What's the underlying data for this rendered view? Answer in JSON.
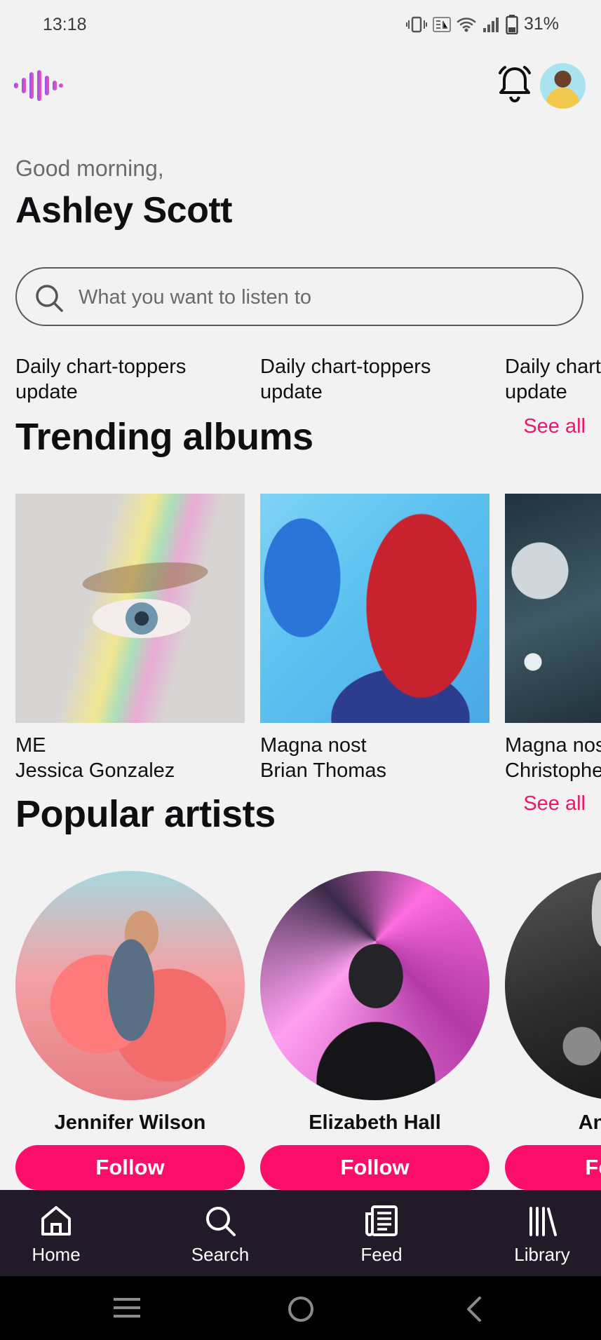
{
  "status_bar": {
    "time": "13:18",
    "battery": "31%"
  },
  "header": {
    "logo_icon": "audio-wave-logo",
    "bell_icon": "bell-icon"
  },
  "greeting": "Good morning,",
  "user_name": "Ashley Scott",
  "search": {
    "placeholder": "What you want to listen to"
  },
  "chart_toppers": [
    {
      "line1": "Daily chart-toppers",
      "line2": "update"
    },
    {
      "line1": "Daily chart-toppers",
      "line2": "update"
    },
    {
      "line1": "Daily chart-toppers",
      "line2": "update"
    }
  ],
  "trending": {
    "title": "Trending albums",
    "see_all": "See all",
    "albums": [
      {
        "title": "ME",
        "artist": "Jessica Gonzalez"
      },
      {
        "title": "Magna nost",
        "artist": "Brian Thomas"
      },
      {
        "title": "Magna nost",
        "artist": "Christopher"
      }
    ]
  },
  "artists_section": {
    "title": "Popular artists",
    "see_all": "See all",
    "artists": [
      {
        "name": "Jennifer Wilson",
        "follow": "Follow"
      },
      {
        "name": "Elizabeth Hall",
        "follow": "Follow"
      },
      {
        "name": "Anthony",
        "follow": "Follow"
      }
    ]
  },
  "nav": [
    {
      "label": "Home",
      "icon": "home-icon"
    },
    {
      "label": "Search",
      "icon": "search-icon"
    },
    {
      "label": "Feed",
      "icon": "feed-icon"
    },
    {
      "label": "Library",
      "icon": "library-icon"
    }
  ],
  "colors": {
    "accent": "#fc0f6b",
    "nav_bg": "#231a29",
    "background": "#f2f2f2"
  }
}
